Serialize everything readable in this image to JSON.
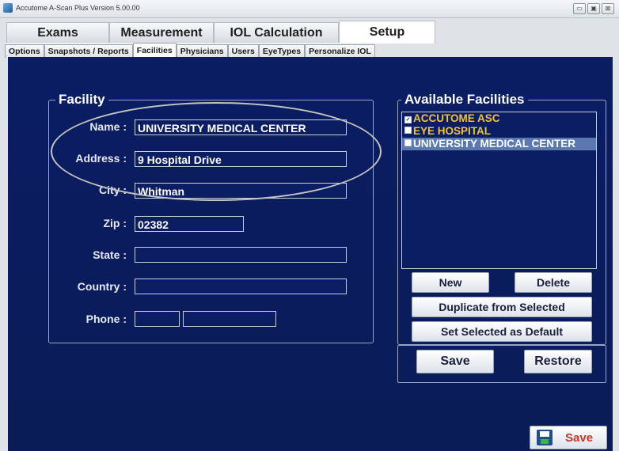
{
  "window": {
    "title": "Accutome A-Scan Plus Version 5.00.00",
    "controls": [
      "▭",
      "▣",
      "⊠"
    ]
  },
  "main_tabs": [
    {
      "label": "Exams",
      "active": false
    },
    {
      "label": "Measurement",
      "active": false
    },
    {
      "label": "IOL Calculation",
      "active": false
    },
    {
      "label": "Setup",
      "active": true
    }
  ],
  "sub_tabs": [
    {
      "label": "Options",
      "active": false
    },
    {
      "label": "Snapshots / Reports",
      "active": false
    },
    {
      "label": "Facilities",
      "active": true
    },
    {
      "label": "Physicians",
      "active": false
    },
    {
      "label": "Users",
      "active": false
    },
    {
      "label": "EyeTypes",
      "active": false
    },
    {
      "label": "Personalize IOL",
      "active": false
    }
  ],
  "facility": {
    "title": "Facility",
    "name_label": "Name :",
    "name_value": "UNIVERSITY MEDICAL CENTER",
    "address_label": "Address :",
    "address_value": "9 Hospital Drive",
    "city_label": "City :",
    "city_value": "Whitman",
    "zip_label": "Zip :",
    "zip_value": "02382",
    "state_label": "State :",
    "state_value": "",
    "country_label": "Country :",
    "country_value": "",
    "phone_label": "Phone :",
    "phone_area_value": "",
    "phone_number_value": ""
  },
  "available": {
    "title": "Available Facilities",
    "items": [
      {
        "label": "ACCUTOME ASC",
        "checked": true,
        "selected": false
      },
      {
        "label": "EYE HOSPITAL",
        "checked": false,
        "selected": false
      },
      {
        "label": "UNIVERSITY MEDICAL CENTER",
        "checked": false,
        "selected": true
      }
    ],
    "new_label": "New",
    "delete_label": "Delete",
    "duplicate_label": "Duplicate from Selected",
    "set_default_label": "Set Selected as Default",
    "save_label": "Save",
    "restore_label": "Restore"
  },
  "footer": {
    "save_label": "Save"
  },
  "colors": {
    "panel_bg": "#0b1d63",
    "list_text": "#f0c23b",
    "list_selected_bg": "#5b78b0",
    "save_text": "#c0392b"
  }
}
